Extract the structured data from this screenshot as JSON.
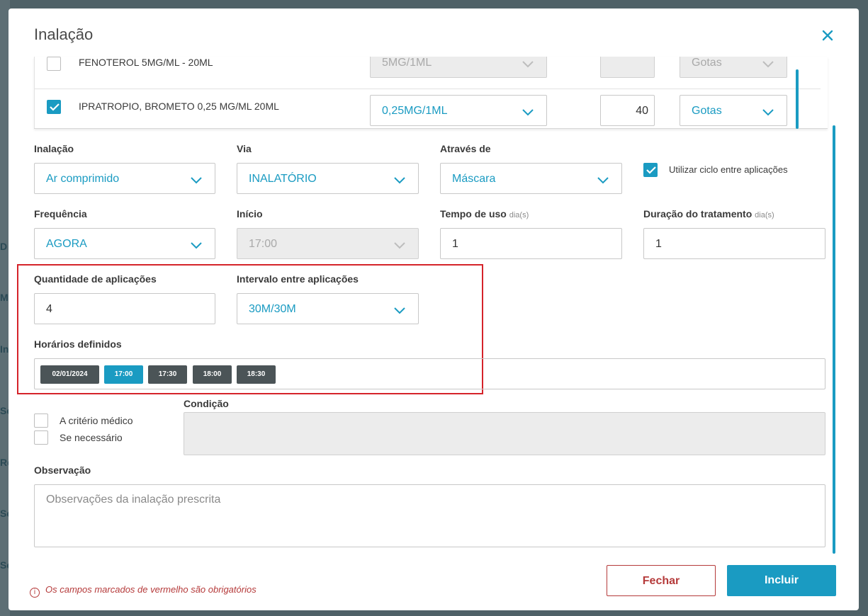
{
  "background": {
    "letters": [
      "D",
      "M",
      "In",
      "Se",
      "Re",
      "Se",
      "Se"
    ]
  },
  "modal": {
    "title": "Inalação",
    "close_icon": "close-icon"
  },
  "medications": [
    {
      "name": "FENOTEROL 5MG/ML - 20ML",
      "checked": false,
      "concentration": "5MG/1ML",
      "quantity": "",
      "unit": "Gotas",
      "disabled": true
    },
    {
      "name": "IPRATROPIO, BROMETO 0,25 MG/ML 20ML",
      "checked": true,
      "concentration": "0,25MG/1ML",
      "quantity": "40",
      "unit": "Gotas",
      "disabled": false
    }
  ],
  "form": {
    "inalacao": {
      "label": "Inalação",
      "value": "Ar comprimido"
    },
    "via": {
      "label": "Via",
      "value": "INALATÓRIO"
    },
    "atraves": {
      "label": "Através de",
      "value": "Máscara"
    },
    "ciclo": {
      "label": "Utilizar ciclo entre aplicações",
      "checked": true
    },
    "frequencia": {
      "label": "Frequência",
      "value": "AGORA"
    },
    "inicio": {
      "label": "Início",
      "value": "17:00"
    },
    "tempo_uso": {
      "label": "Tempo de uso",
      "unit": "dia(s)",
      "value": "1"
    },
    "duracao": {
      "label": "Duração do tratamento",
      "unit": "dia(s)",
      "value": "1"
    },
    "quantidade": {
      "label": "Quantidade de aplicações",
      "value": "4"
    },
    "intervalo": {
      "label": "Intervalo entre aplicações",
      "value": "30M/30M"
    },
    "horarios": {
      "label": "Horários definidos",
      "chips": [
        "02/01/2024",
        "17:00",
        "17:30",
        "18:00",
        "18:30"
      ],
      "active_index": 1
    },
    "criterio": {
      "label": "A critério médico",
      "checked": false
    },
    "necessario": {
      "label": "Se necessário",
      "checked": false
    },
    "condicao": {
      "label": "Condição",
      "value": ""
    },
    "observacao": {
      "label": "Observação",
      "placeholder": "Observações da inalação prescrita"
    }
  },
  "footer": {
    "required_note": "Os campos marcados de vermelho são obrigatórios",
    "close_label": "Fechar",
    "add_label": "Incluir"
  },
  "colors": {
    "accent": "#1a9bc2",
    "danger": "#b53a3a",
    "chip": "#4b5457"
  }
}
